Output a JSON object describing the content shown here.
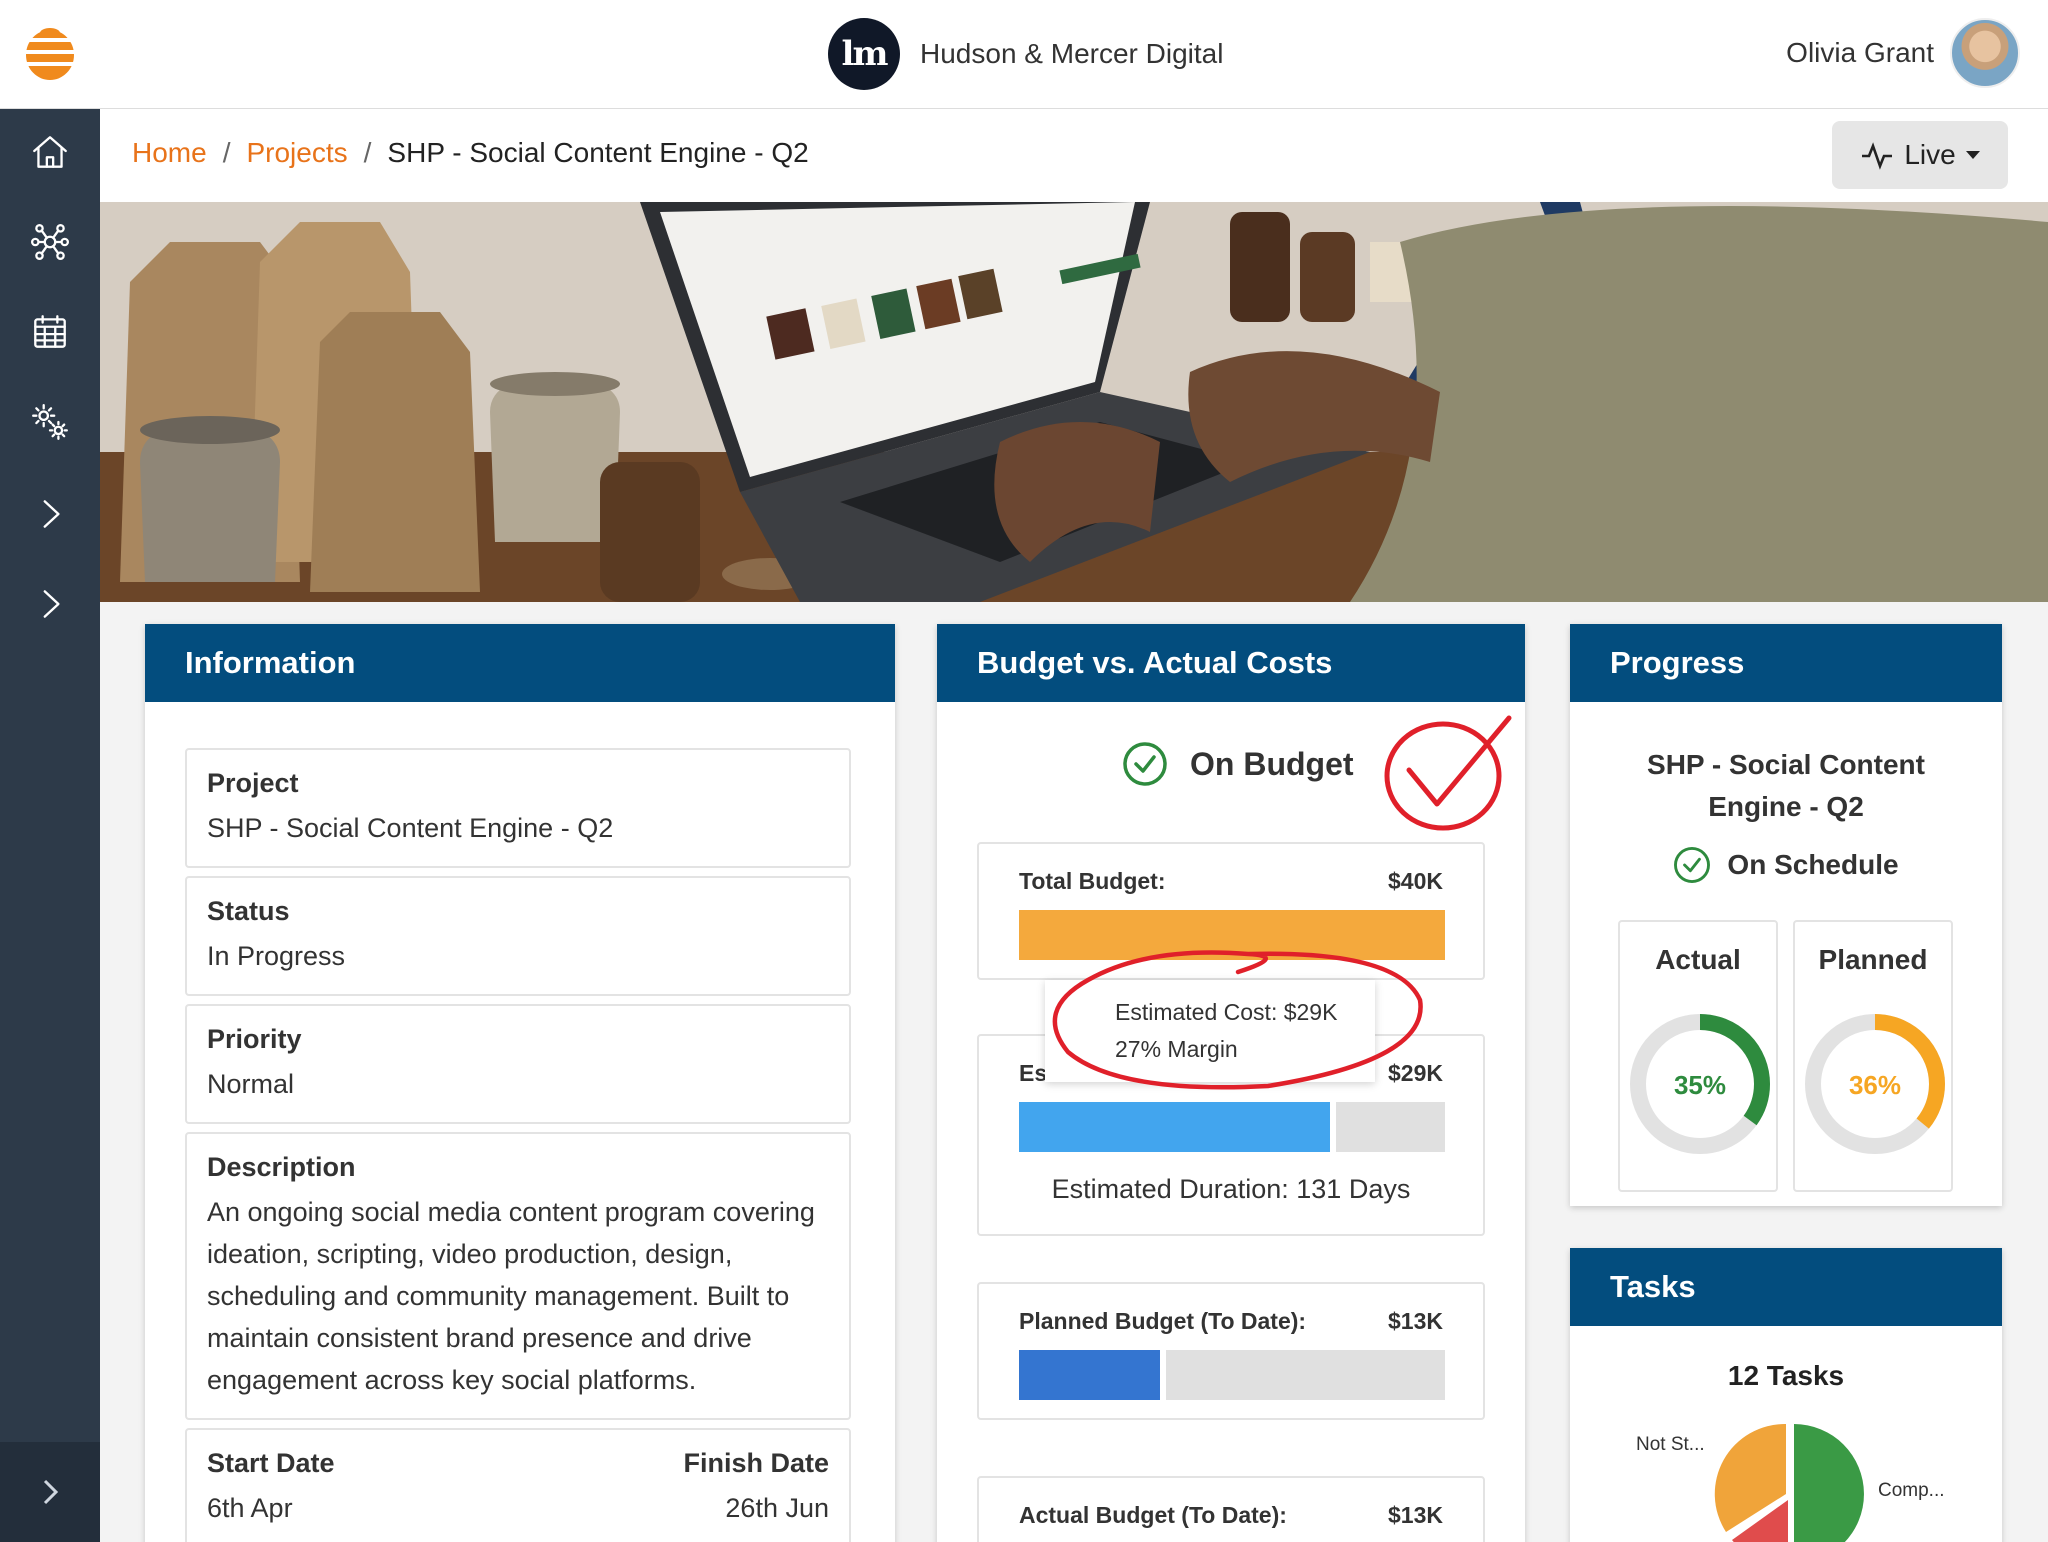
{
  "header": {
    "company_mark": "lm",
    "company_name": "Hudson & Mercer Digital",
    "user_name": "Olivia Grant"
  },
  "sidebar": {
    "items": [
      {
        "icon": "home-icon"
      },
      {
        "icon": "network-icon"
      },
      {
        "icon": "calendar-icon"
      },
      {
        "icon": "settings-icon"
      },
      {
        "icon": "chevron-right-icon"
      },
      {
        "icon": "chevron-right-icon"
      }
    ],
    "expand_icon": "chevron-right-icon"
  },
  "breadcrumb": {
    "home": "Home",
    "projects": "Projects",
    "separator": "/",
    "current": "SHP - Social Content Engine - Q2"
  },
  "live_button": {
    "label": "Live"
  },
  "information": {
    "title": "Information",
    "project_label": "Project",
    "project_value": "SHP - Social Content Engine - Q2",
    "status_label": "Status",
    "status_value": "In Progress",
    "priority_label": "Priority",
    "priority_value": "Normal",
    "description_label": "Description",
    "description_value": "An ongoing social media content program covering ideation, scripting, video production, design, scheduling and community management. Built to maintain consistent brand presence and drive engagement across key social platforms.",
    "start_label": "Start Date",
    "start_value": "6th Apr",
    "finish_label": "Finish Date",
    "finish_value": "26th Jun"
  },
  "budget": {
    "title": "Budget vs. Actual Costs",
    "status": "On Budget",
    "total_label": "Total Budget:",
    "total_value": "$40K",
    "total_fill": 1.0,
    "estimated_label": "Estima",
    "estimated_value": "$29K",
    "estimated_fill": 0.73,
    "duration": "Estimated Duration: 131 Days",
    "planned_label": "Planned Budget (To Date):",
    "planned_value": "$13K",
    "planned_fill": 0.33,
    "actual_label": "Actual Budget (To Date):",
    "actual_value": "$13K",
    "tooltip_line1": "Estimated Cost: $29K",
    "tooltip_line2": "27% Margin",
    "colors": {
      "total": "#f4a93d",
      "estimated": "#42a5ee",
      "planned": "#3475d0",
      "on_budget": "#2e8b3e",
      "annotation": "#e0202a"
    }
  },
  "progress": {
    "title": "Progress",
    "project_name": "SHP - Social Content Engine - Q2",
    "status": "On Schedule",
    "actual_label": "Actual",
    "actual_value": "35%",
    "actual_fraction": 0.35,
    "planned_label": "Planned",
    "planned_value": "36%",
    "planned_fraction": 0.36,
    "colors": {
      "actual": "#2e8b3e",
      "planned": "#f6a623",
      "track": "#e2e2e2"
    }
  },
  "tasks": {
    "title": "Tasks",
    "count": "12 Tasks",
    "not_started_label": "Not St...",
    "completed_label": "Comp...",
    "colors": {
      "completed": "#3a9a45",
      "not_started": "#f0a43a",
      "other": "#e04c4c"
    }
  }
}
